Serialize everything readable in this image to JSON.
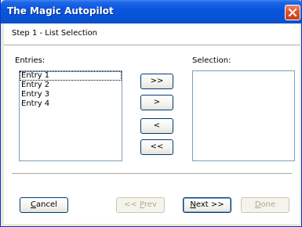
{
  "window": {
    "title": "The Magic Autopilot",
    "close_icon": "close-icon"
  },
  "header": {
    "step": "Step 1 - List Selection"
  },
  "entries": {
    "label": "Entries:",
    "items": [
      "Entry 1",
      "Entry 2",
      "Entry 3",
      "Entry 4"
    ],
    "focused_index": 0
  },
  "selection": {
    "label": "Selection:",
    "items": []
  },
  "transfer": {
    "add_all": ">>",
    "add_one": ">",
    "remove_one": "<",
    "remove_all": "<<"
  },
  "footer": {
    "cancel_label": "Cancel",
    "prev_label": "<< Prev",
    "next_label": "Next >>",
    "done_label": "Done",
    "cancel_mnemonic": "C",
    "prev_mnemonic": "P",
    "next_mnemonic": "N",
    "done_mnemonic": "D"
  },
  "colors": {
    "titlebar": "#0a55de",
    "border": "#0831d9",
    "close": "#e2542d",
    "disabled_text": "#aca899"
  }
}
